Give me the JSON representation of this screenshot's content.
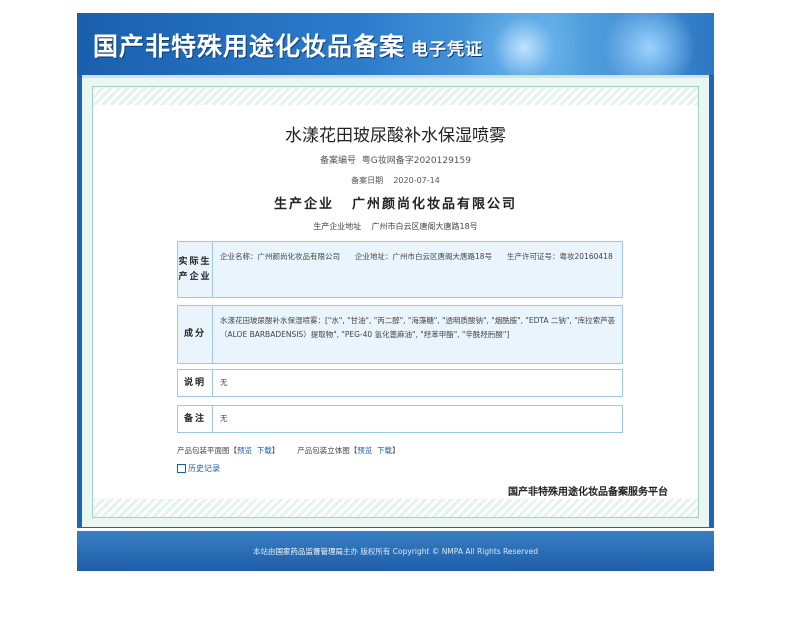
{
  "banner": {
    "title": "国产非特殊用途化妆品备案",
    "subtitle": "电子凭证"
  },
  "certificate": {
    "product_name": "水漾花田玻尿酸补水保湿喷雾",
    "registration_label": "备案编号",
    "registration_number": "粤G妆网备字2020129159",
    "date_label": "备案日期",
    "date": "2020-07-14",
    "company_label": "生产企业",
    "company_name": "广州颜尚化妆品有限公司",
    "address_label": "生产企业地址",
    "address": "广州市白云区唐阁大唐路18号"
  },
  "sections": {
    "producer": {
      "label": "实际生产企业",
      "value": "企业名称：广州颜尚化妆品有限公司　　企业地址：广州市白云区唐阁大唐路18号　　生产许可证号：粤妆20160418"
    },
    "ingredients": {
      "label": "成分",
      "value": "水漾花田玻尿酸补水保湿喷雾：[\"水\", \"甘油\", \"丙二醇\", \"海藻糖\", \"透明质酸钠\", \"烟酰胺\", \"EDTA 二钠\", \"库拉索芦荟（ALOE BARBADENSIS）提取物\", \"PEG-40 氢化蓖麻油\", \"羟苯甲酯\", \"辛酰羟肟酸\"]"
    },
    "description": {
      "label": "说明",
      "value": "无"
    },
    "remark": {
      "label": "备注",
      "value": "无"
    }
  },
  "links": {
    "flat_label": "产品包装平面图【",
    "flat_preview": "预览",
    "flat_download": "下载",
    "solid_label": "产品包装立体图【",
    "solid_preview": "预览",
    "solid_download": "下载",
    "close_bracket": "】",
    "history": "历史记录"
  },
  "platform_name": "国产非特殊用途化妆品备案服务平台",
  "footer": {
    "prefix": "本站由",
    "agency": "国家药品监督管理局",
    "suffix": "主办 版权所有 Copyright © NMPA All Rights Reserved"
  },
  "icons": {
    "history": "history-icon"
  },
  "colors": {
    "brand_blue": "#1e64b4",
    "link_blue": "#1a5fae",
    "box_bg": "#eaf4fd",
    "box_border": "#9ec8e6"
  }
}
